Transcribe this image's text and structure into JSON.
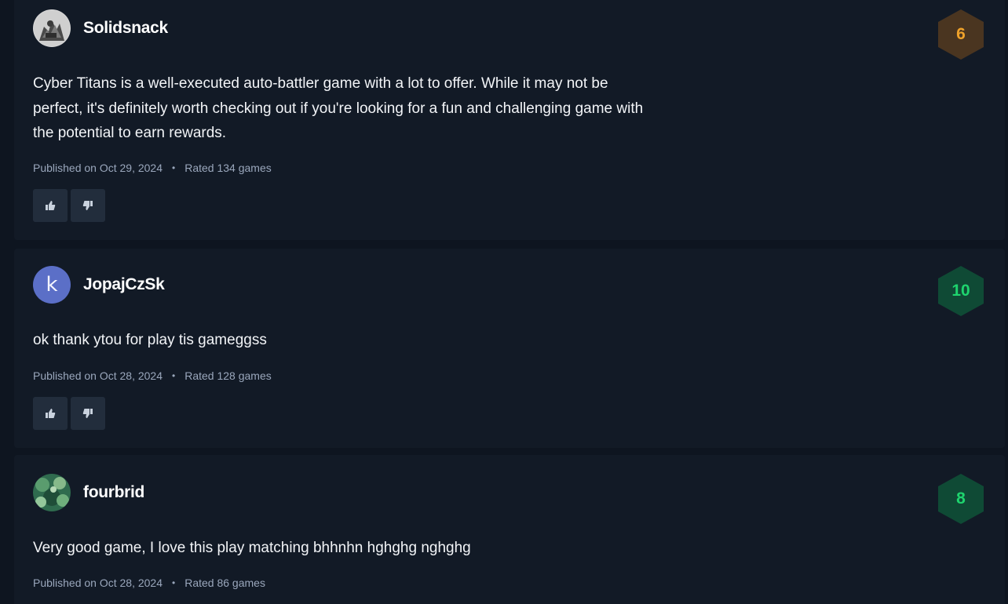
{
  "reviews": [
    {
      "username": "Solidsnack",
      "avatar": "photo-avatar-grayscale",
      "score": "6",
      "score_color": "#f0a22a",
      "score_bg": "#4a3520",
      "text": "Cyber Titans is a well-executed auto-battler game with a lot to offer. While it may not be perfect, it's definitely worth checking out if you're looking for a fun and challenging game with the potential to earn rewards.",
      "published": "Published on Oct 29, 2024",
      "separator": "•",
      "rated": "Rated 134 games",
      "like_icon": "thumbs-up-icon",
      "dislike_icon": "thumbs-down-icon"
    },
    {
      "username": "JopajCzSk",
      "avatar_letter": "k",
      "avatar_color": "#5b6fc7",
      "score": "10",
      "score_color": "#1ed46e",
      "score_bg": "#0f4a35",
      "text": "ok thank ytou for play tis gameggss",
      "published": "Published on Oct 28, 2024",
      "separator": "•",
      "rated": "Rated 128 games",
      "like_icon": "thumbs-up-icon",
      "dislike_icon": "thumbs-down-icon"
    },
    {
      "username": "fourbrid",
      "avatar": "photo-avatar-green",
      "score": "8",
      "score_color": "#1ed46e",
      "score_bg": "#0f4a35",
      "text": "Very good game, I love this play matching bhhnhn hghghg nghghg",
      "published": "Published on Oct 28, 2024",
      "separator": "•",
      "rated": "Rated 86 games"
    }
  ]
}
